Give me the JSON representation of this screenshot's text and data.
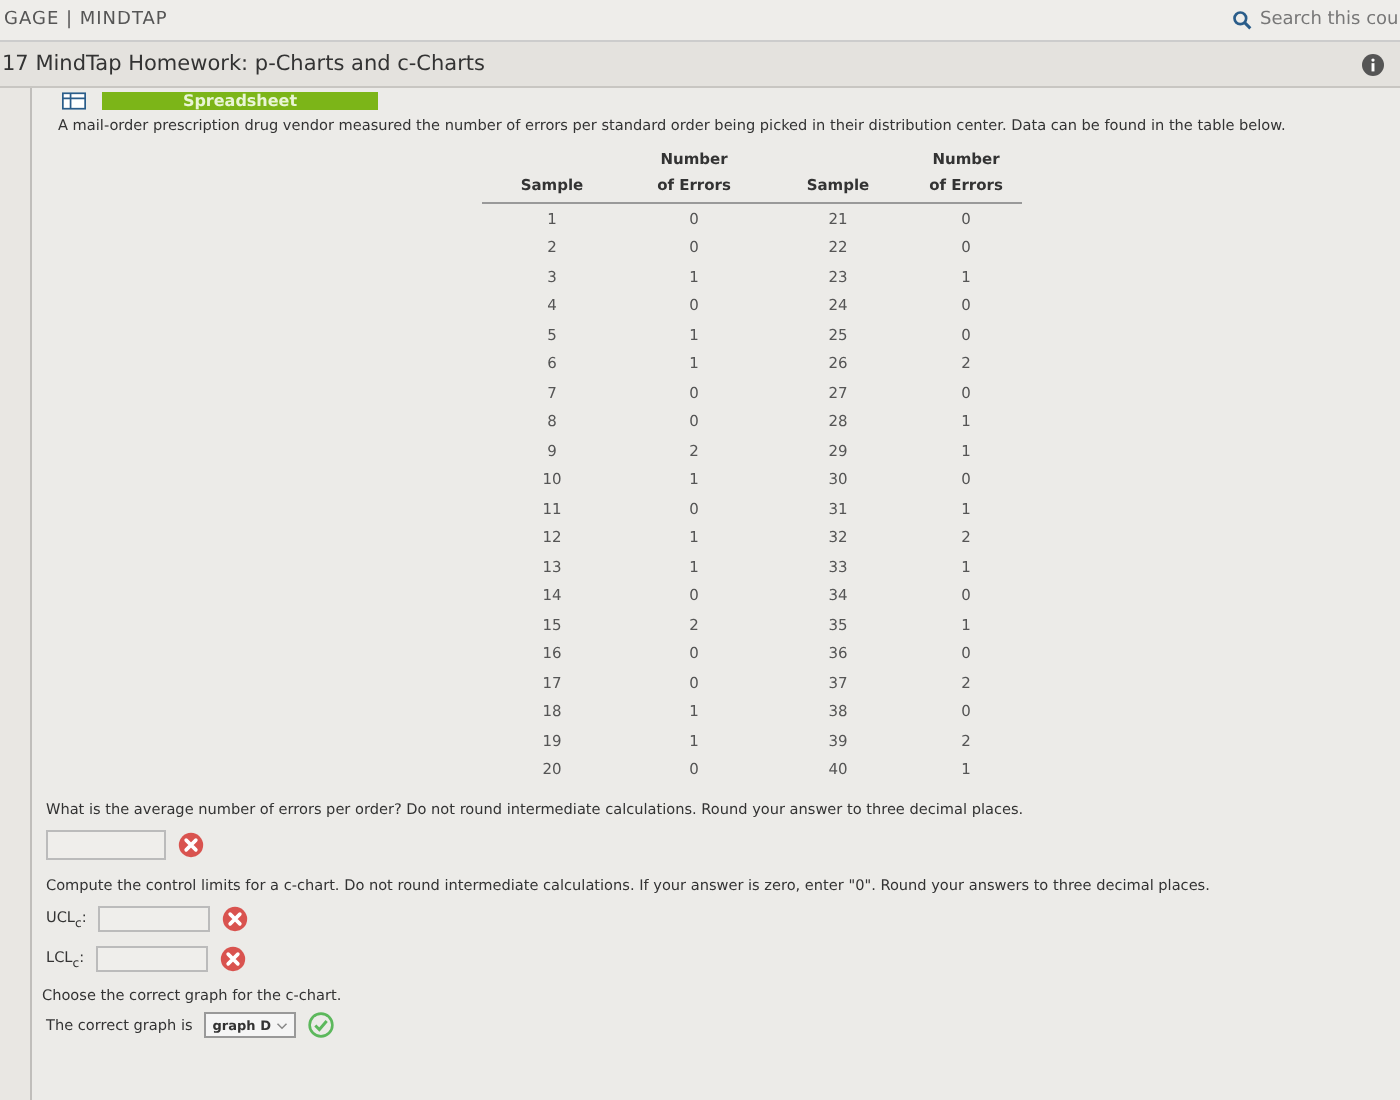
{
  "top_bar": {
    "brand": "GAGE | MINDTAP",
    "search_placeholder": "Search this cou"
  },
  "title_bar": {
    "title": "17 MindTap Homework: p-Charts and c-Charts"
  },
  "spreadsheet_button": {
    "label": "Spreadsheet"
  },
  "intro": "A mail-order prescription drug vendor measured the number of errors per standard order being picked in their distribution center. Data can be found in the table below.",
  "table": {
    "columns": [
      {
        "line2": "Sample"
      },
      {
        "line1": "Number",
        "line2": "of Errors"
      },
      {
        "line2": "Sample"
      },
      {
        "line1": "Number",
        "line2": "of Errors"
      }
    ],
    "rows": [
      [
        "1",
        "0",
        "21",
        "0"
      ],
      [
        "2",
        "0",
        "22",
        "0"
      ],
      [
        "3",
        "1",
        "23",
        "1"
      ],
      [
        "4",
        "0",
        "24",
        "0"
      ],
      [
        "5",
        "1",
        "25",
        "0"
      ],
      [
        "6",
        "1",
        "26",
        "2"
      ],
      [
        "7",
        "0",
        "27",
        "0"
      ],
      [
        "8",
        "0",
        "28",
        "1"
      ],
      [
        "9",
        "2",
        "29",
        "1"
      ],
      [
        "10",
        "1",
        "30",
        "0"
      ],
      [
        "11",
        "0",
        "31",
        "1"
      ],
      [
        "12",
        "1",
        "32",
        "2"
      ],
      [
        "13",
        "1",
        "33",
        "1"
      ],
      [
        "14",
        "0",
        "34",
        "0"
      ],
      [
        "15",
        "2",
        "35",
        "1"
      ],
      [
        "16",
        "0",
        "36",
        "0"
      ],
      [
        "17",
        "0",
        "37",
        "2"
      ],
      [
        "18",
        "1",
        "38",
        "0"
      ],
      [
        "19",
        "1",
        "39",
        "2"
      ],
      [
        "20",
        "0",
        "40",
        "1"
      ]
    ]
  },
  "question_1": {
    "text": "What is the average number of errors per order? Do not round intermediate calculations. Round your answer to three decimal places.",
    "answer": {
      "correct": false
    }
  },
  "question_2": {
    "text": "Compute the control limits for a c-chart. Do not round intermediate calculations. If your answer is zero, enter \"0\". Round your answers to three decimal places.",
    "answers": [
      {
        "label": "UCL$_{c}$:",
        "correct": false
      },
      {
        "label": "LCL$_{c}$:",
        "correct": false
      }
    ]
  },
  "question_3": {
    "text": "Choose the correct graph for the c-chart.",
    "prompt": "The correct graph is",
    "select": {
      "value": "graph D",
      "correct": true
    }
  }
}
